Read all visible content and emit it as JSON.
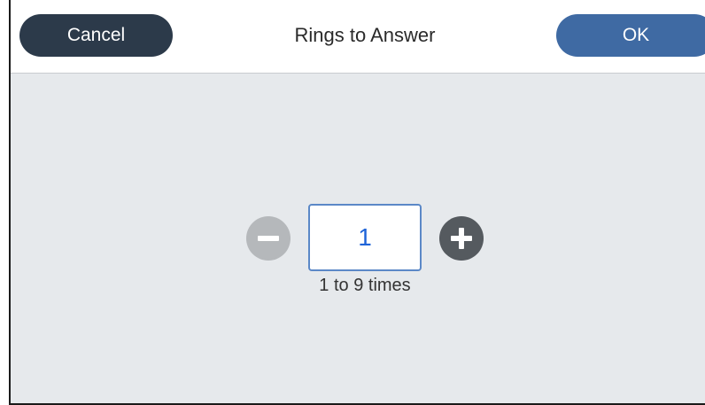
{
  "header": {
    "cancel_label": "Cancel",
    "title": "Rings to Answer",
    "ok_label": "OK"
  },
  "stepper": {
    "value": "1",
    "hint": "1 to 9 times",
    "decrement_icon": "minus-circle-icon",
    "increment_icon": "plus-circle-icon"
  },
  "colors": {
    "cancel_button": "#2c3a4a",
    "ok_button": "#3f6aa3",
    "background": "#e6e9ec",
    "value_text": "#1f64d8",
    "decrement_disabled": "#b5b8bb",
    "increment": "#555a5f"
  }
}
